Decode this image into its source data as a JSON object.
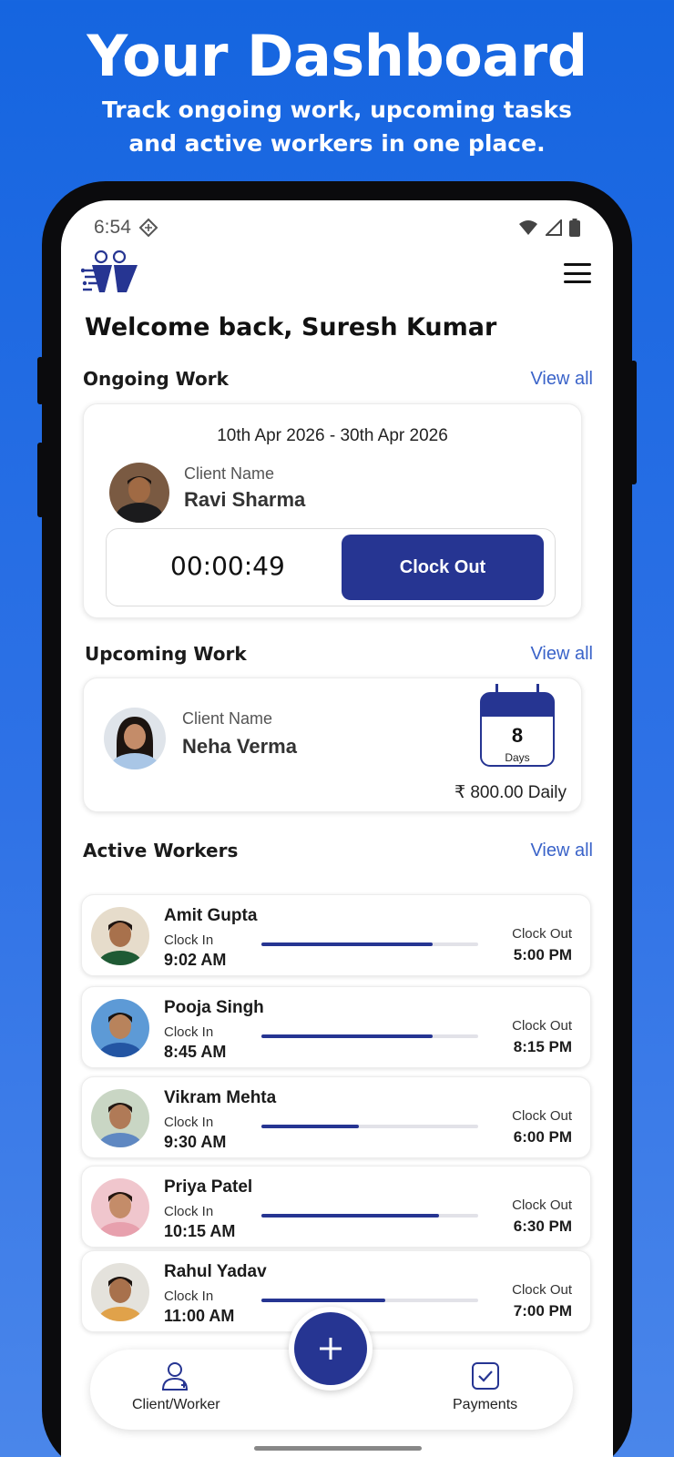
{
  "promo": {
    "title": "Your Dashboard",
    "subtitle_line1": "Track ongoing work, upcoming tasks",
    "subtitle_line2": "and active workers in one place."
  },
  "status_bar": {
    "time": "6:54"
  },
  "welcome": "Welcome back, Suresh Kumar",
  "ongoing": {
    "title": "Ongoing Work",
    "view_all": "View all",
    "date_range": "10th Apr 2026 - 30th Apr 2026",
    "client_label": "Client Name",
    "client_name": "Ravi Sharma",
    "timer": "00:00:49",
    "clock_out_label": "Clock Out"
  },
  "upcoming": {
    "title": "Upcoming Work",
    "view_all": "View all",
    "client_label": "Client Name",
    "client_name": "Neha Verma",
    "days_number": "8",
    "days_label": "Days",
    "rate": "₹ 800.00 Daily"
  },
  "active_workers": {
    "title": "Active Workers",
    "view_all": "View all",
    "clock_in_label": "Clock In",
    "clock_out_label": "Clock Out",
    "workers": [
      {
        "name": "Amit Gupta",
        "clock_in": "9:02 AM",
        "clock_out": "5:00 PM",
        "progress": 0.79,
        "skin": "#a8714c",
        "hair": "#1e1410",
        "shirt": "#1f5a34",
        "bg": "#e6dccb"
      },
      {
        "name": "Pooja Singh",
        "clock_in": "8:45 AM",
        "clock_out": "8:15 PM",
        "progress": 0.79,
        "skin": "#b8835c",
        "hair": "#1a1411",
        "shirt": "#2355a3",
        "bg": "#5d9ad6"
      },
      {
        "name": "Vikram Mehta",
        "clock_in": "9:30 AM",
        "clock_out": "6:00 PM",
        "progress": 0.45,
        "skin": "#b07a57",
        "hair": "#231813",
        "shirt": "#5f88c2",
        "bg": "#c9d6c4"
      },
      {
        "name": "Priya Patel",
        "clock_in": "10:15 AM",
        "clock_out": "6:30 PM",
        "progress": 0.82,
        "skin": "#c48c69",
        "hair": "#24160f",
        "shirt": "#e7a0ad",
        "bg": "#f0c6cd"
      },
      {
        "name": "Rahul Yadav",
        "clock_in": "11:00 AM",
        "clock_out": "7:00 PM",
        "progress": 0.57,
        "skin": "#a8714c",
        "hair": "#1c130f",
        "shirt": "#e0a24a",
        "bg": "#e4e2dc"
      }
    ]
  },
  "nav": {
    "client_worker": "Client/Worker",
    "payments": "Payments"
  },
  "colors": {
    "primary": "#263592",
    "link": "#3a63c9",
    "background_top": "#1565e0"
  },
  "icons": [
    "brand-logo-icon",
    "menu-icon",
    "wifi-icon",
    "signal-icon",
    "battery-icon",
    "calendar-icon",
    "add-icon",
    "user-add-icon",
    "payments-check-icon"
  ]
}
